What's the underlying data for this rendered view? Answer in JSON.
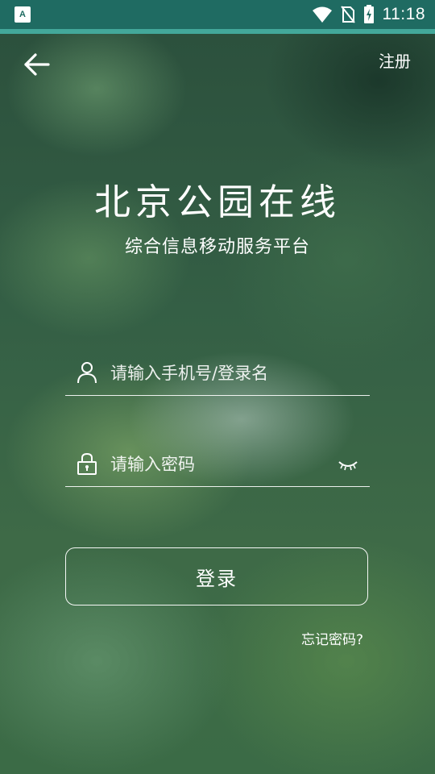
{
  "status_bar": {
    "time": "11:18",
    "app_icon_letter": "A",
    "icons": [
      "wifi-icon",
      "no-sim-icon",
      "battery-charging-icon"
    ]
  },
  "nav": {
    "back_icon": "arrow-left-icon",
    "register_label": "注册"
  },
  "header": {
    "title": "北京公园在线",
    "subtitle": "综合信息移动服务平台"
  },
  "form": {
    "username": {
      "placeholder": "请输入手机号/登录名",
      "value": "",
      "icon": "user-icon"
    },
    "password": {
      "placeholder": "请输入密码",
      "value": "",
      "icon": "lock-icon",
      "toggle_icon": "eye-closed-icon"
    },
    "login_label": "登录",
    "forgot_label": "忘记密码?"
  },
  "colors": {
    "status_bar": "#1f6b62",
    "accent_line": "#43a89a",
    "text": "#ffffff"
  }
}
